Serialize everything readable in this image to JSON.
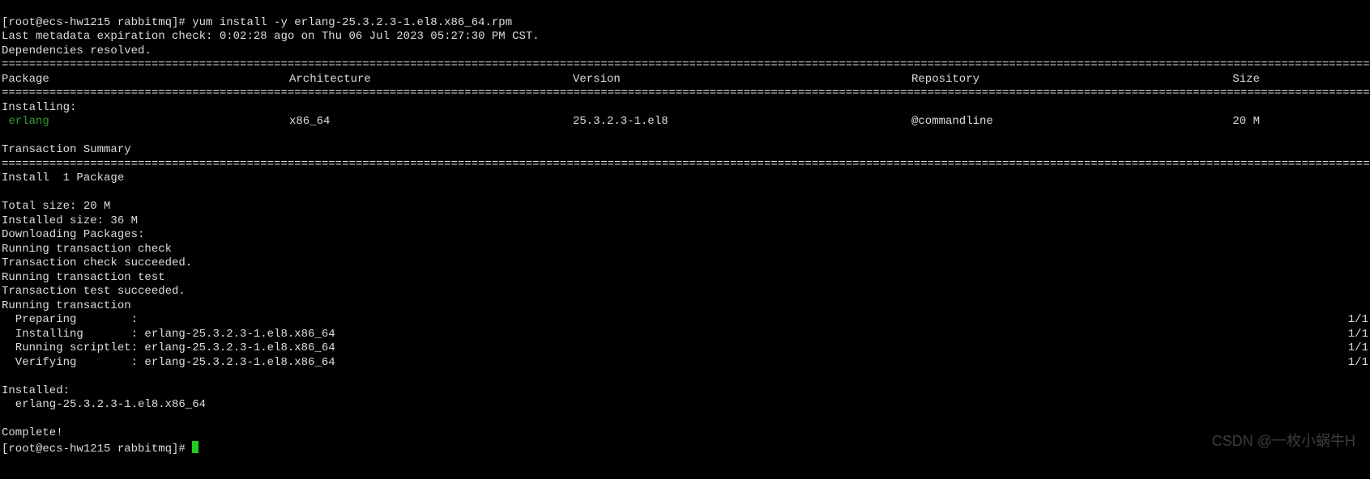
{
  "prompt1": "[root@ecs-hw1215 rabbitmq]# ",
  "command": "yum install -y erlang-25.3.2.3-1.el8.x86_64.rpm",
  "line_metadata": "Last metadata expiration check: 0:02:28 ago on Thu 06 Jul 2023 05:27:30 PM CST.",
  "line_deps": "Dependencies resolved.",
  "hdr": {
    "package": "Package",
    "arch": "Architecture",
    "version": "Version",
    "repo": "Repository",
    "size": "Size"
  },
  "installing_label": "Installing:",
  "pkg": {
    "name": " erlang",
    "arch": "x86_64",
    "version": "25.3.2.3-1.el8",
    "repo": "@commandline",
    "size": "20 M"
  },
  "tx_summary": "Transaction Summary",
  "install_count": "Install  1 Package",
  "total_size": "Total size: 20 M",
  "installed_size": "Installed size: 36 M",
  "downloading": "Downloading Packages:",
  "run_check": "Running transaction check",
  "check_ok": "Transaction check succeeded.",
  "run_test": "Running transaction test",
  "test_ok": "Transaction test succeeded.",
  "run_tx": "Running transaction",
  "steps": {
    "prepare": "  Preparing        :",
    "install": "  Installing       : erlang-25.3.2.3-1.el8.x86_64",
    "scriptlet": "  Running scriptlet: erlang-25.3.2.3-1.el8.x86_64",
    "verify": "  Verifying        : erlang-25.3.2.3-1.el8.x86_64",
    "progress": "1/1"
  },
  "installed_hdr": "Installed:",
  "installed_pkg": "  erlang-25.3.2.3-1.el8.x86_64",
  "complete": "Complete!",
  "prompt2": "[root@ecs-hw1215 rabbitmq]# ",
  "watermark": "CSDN @一枚小蜗牛H"
}
